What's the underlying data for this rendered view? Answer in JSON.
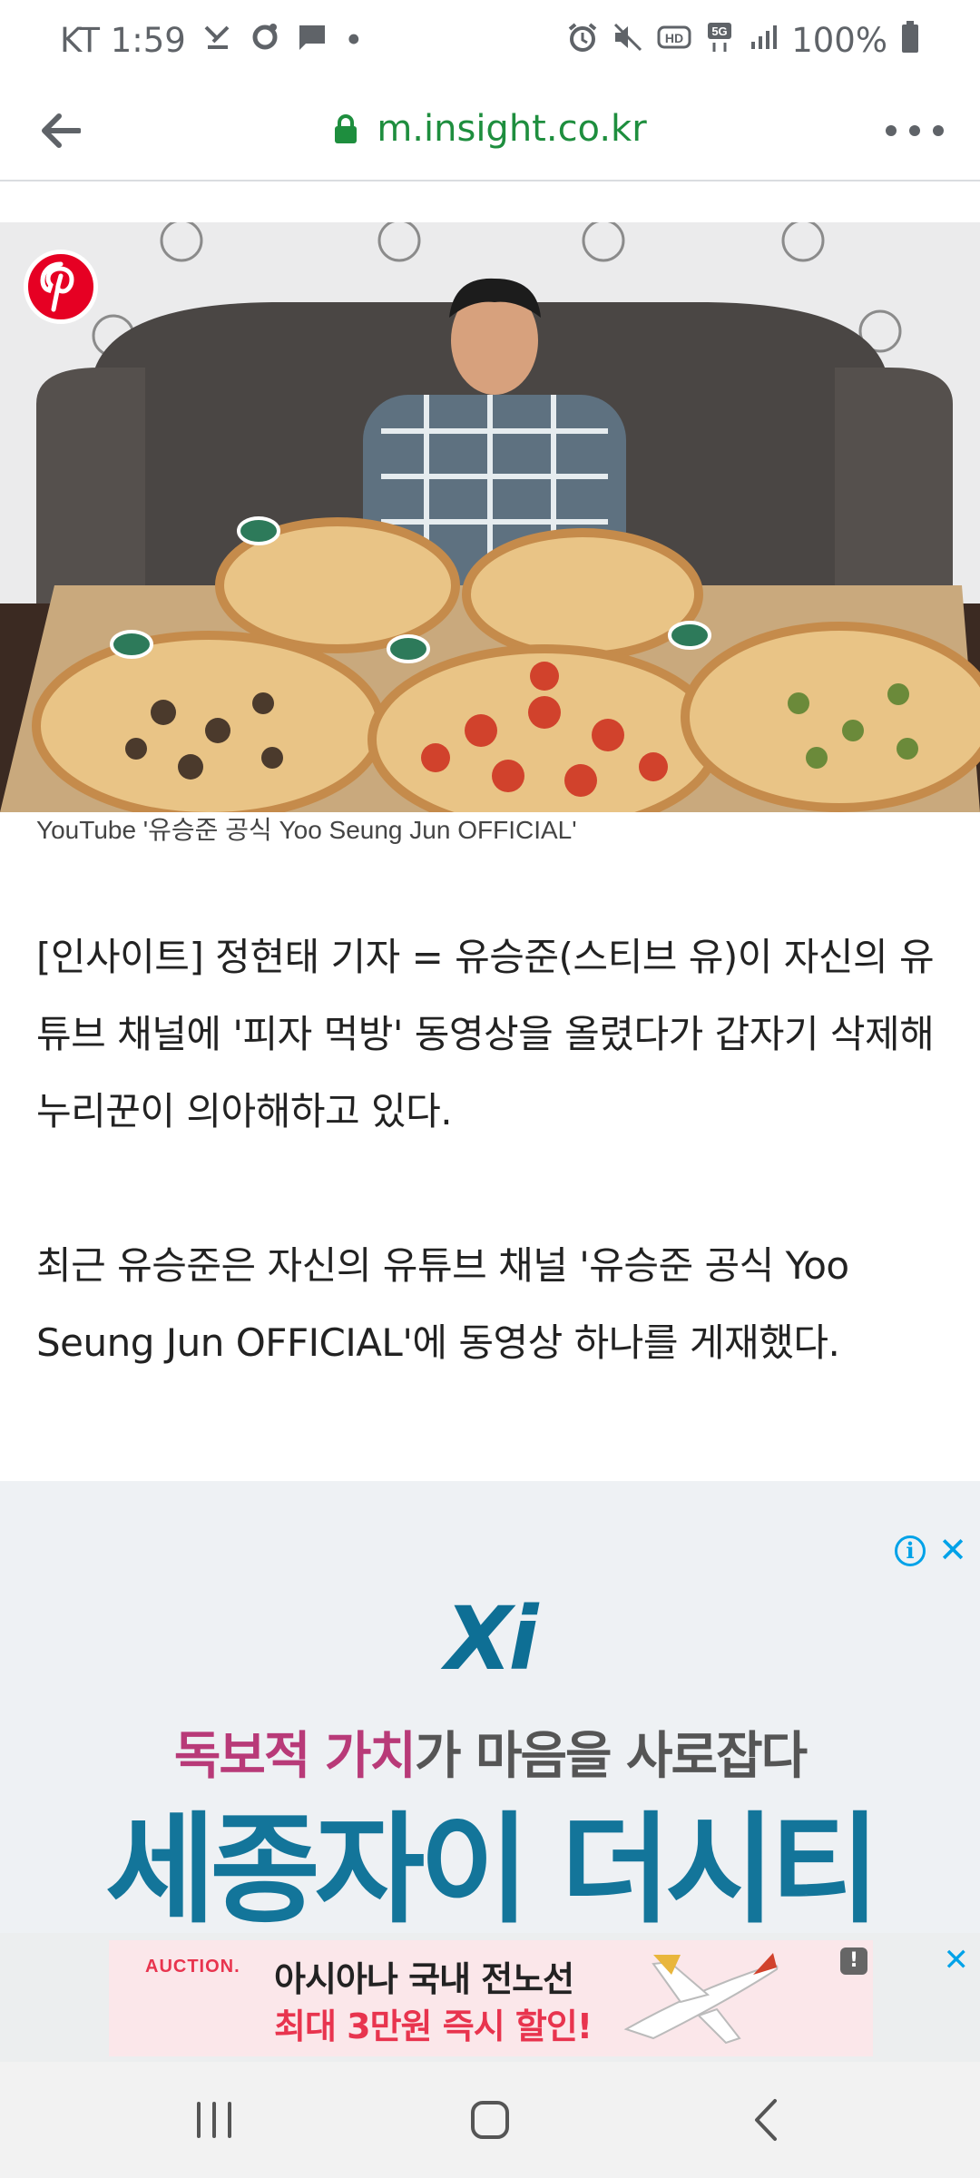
{
  "status_bar": {
    "carrier_time": "KT 1:59",
    "dot": "•",
    "battery": "100%",
    "left_icons": [
      "missed-call-icon",
      "settings-icon",
      "message-icon"
    ],
    "right_icons": [
      "alarm-icon",
      "mute-icon",
      "hd-icon",
      "5g-icon",
      "signal-icon",
      "battery-icon"
    ]
  },
  "browser": {
    "url": "m.insight.co.kr"
  },
  "hero": {
    "caption": "YouTube '유승준 공식 Yoo Seung Jun OFFICIAL'"
  },
  "article": {
    "paragraphs": [
      "[인사이트] 정현태 기자 = 유승준(스티브 유)이 자신의 유튜브 채널에 '피자 먹방' 동영상을 올렸다가 갑자기 삭제해 누리꾼이 의아해하고 있다.",
      "최근 유승준은 자신의 유튜브 채널 '유승준 공식 Yoo Seung Jun OFFICIAL'에 동영상 하나를 게재했다."
    ]
  },
  "ad": {
    "logo": "Xi",
    "slogan_highlight": "독보적 가치",
    "slogan_rest": "가 마음을 사로잡다",
    "title": "세종자이 더시티",
    "info_label": "i",
    "close_label": "✕"
  },
  "banner": {
    "brand": "AUCTION.",
    "line1": "아시아나 국내 전노선",
    "line2": "최대 3만원 즉시 할인!",
    "badge": "!",
    "close_label": "✕"
  },
  "colors": {
    "url_green": "#1e8e3e",
    "pinterest": "#e60023",
    "ad_blue": "#13759a",
    "ad_pink": "#b83a78",
    "auction_red": "#e8344e"
  }
}
